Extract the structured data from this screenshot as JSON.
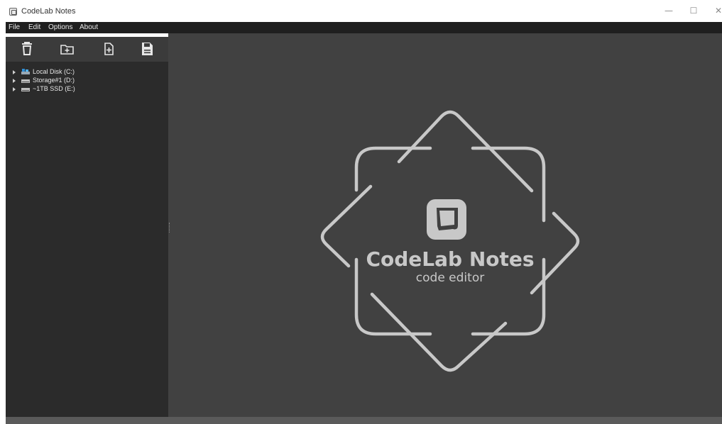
{
  "window": {
    "title": "CodeLab Notes",
    "controls": [
      "minimize",
      "maximize",
      "close"
    ]
  },
  "menu": {
    "items": [
      "File",
      "Edit",
      "Options",
      "About"
    ]
  },
  "toolbar": {
    "icons": [
      "trash-icon",
      "new-folder-icon",
      "new-file-icon",
      "save-icon"
    ]
  },
  "tree": {
    "drives": [
      {
        "label": "Local Disk (C:)",
        "icon": "system-drive-icon"
      },
      {
        "label": "Storage#1 (D:)",
        "icon": "drive-icon"
      },
      {
        "label": "~1TB SSD (E:)",
        "icon": "drive-icon"
      }
    ]
  },
  "splash": {
    "title": "CodeLab Notes",
    "subtitle": "code editor"
  },
  "colors": {
    "menubar": "#1f1f1f",
    "sidebar": "#2b2b2b",
    "toolbar": "#3b3b3b",
    "editor": "#414141",
    "logo": "#c8c8c8"
  }
}
